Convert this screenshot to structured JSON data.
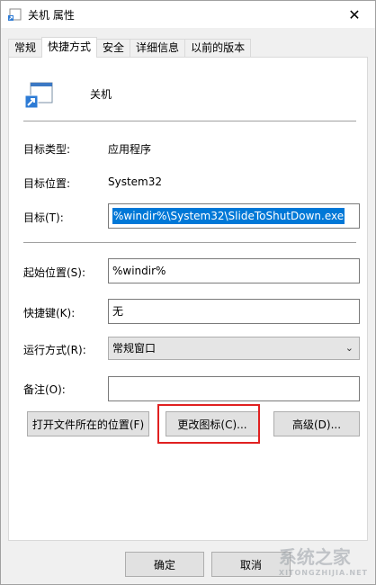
{
  "window": {
    "title": "关机 属性",
    "close_glyph": "✕"
  },
  "tabs": [
    {
      "label": "常规",
      "active": false
    },
    {
      "label": "快捷方式",
      "active": true
    },
    {
      "label": "安全",
      "active": false
    },
    {
      "label": "详细信息",
      "active": false
    },
    {
      "label": "以前的版本",
      "active": false
    }
  ],
  "shortcut": {
    "name": "关机",
    "target_type_label": "目标类型:",
    "target_type_value": "应用程序",
    "target_location_label": "目标位置:",
    "target_location_value": "System32",
    "target_label": "目标(T):",
    "target_value": "%windir%\\System32\\SlideToShutDown.exe",
    "start_in_label": "起始位置(S):",
    "start_in_value": "%windir%",
    "hotkey_label": "快捷键(K):",
    "hotkey_value": "无",
    "run_label": "运行方式(R):",
    "run_value": "常规窗口",
    "comment_label": "备注(O):",
    "comment_value": ""
  },
  "buttons": {
    "open_location": "打开文件所在的位置(F)",
    "change_icon": "更改图标(C)...",
    "advanced": "高级(D)...",
    "ok": "确定",
    "cancel": "取消"
  },
  "watermark": {
    "text": "系统之家",
    "sub": "XITONGZHIJIA.NET"
  },
  "colors": {
    "selection": "#0078d7",
    "highlight_box": "#e02020"
  }
}
